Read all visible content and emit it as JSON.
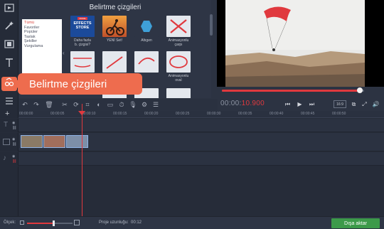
{
  "panel": {
    "title": "Belirtme çizgileri",
    "categories": [
      "Tümü",
      "Favoriler",
      "Popüler",
      "Taslak",
      "Şekiller",
      "Vurgulama"
    ],
    "selected_category": "Tümü",
    "thumbnails": [
      {
        "label": "Daha fazla\nb. çizgisi?",
        "badge": "MORE",
        "overlay": "EFFECTS\nSTORE"
      },
      {
        "label": "YENİ Set!"
      },
      {
        "label": "Altıgen"
      },
      {
        "label": "Animasyonlu\nçarpı"
      },
      {
        "label": "…k"
      },
      {
        "label": "Animasyonlu\noval"
      }
    ]
  },
  "callout": {
    "text": "Belirtme çizgileri"
  },
  "player": {
    "timecode_dim": "00:00:",
    "timecode_hot": "10.900",
    "ratio": "16:9",
    "progress": 0.97
  },
  "timeline": {
    "ruler": [
      "00:00:00",
      "00:00:05",
      "00:00:10",
      "00:00:15",
      "00:00:20",
      "00:00:25",
      "00:00:30",
      "00:00:35",
      "00:00:40",
      "00:00:45",
      "00:00:50"
    ]
  },
  "status": {
    "scale_label": "Ölçek:",
    "scale_value": 0.58,
    "duration_label": "Proje uzunluğu:",
    "duration_value": "00:12",
    "export_label": "Dışa aktar"
  },
  "colors": {
    "accent": "#ee6c4e",
    "timecode": "#e0393e",
    "export": "#3c9a4a",
    "clip_border": "#8fb4e8"
  }
}
